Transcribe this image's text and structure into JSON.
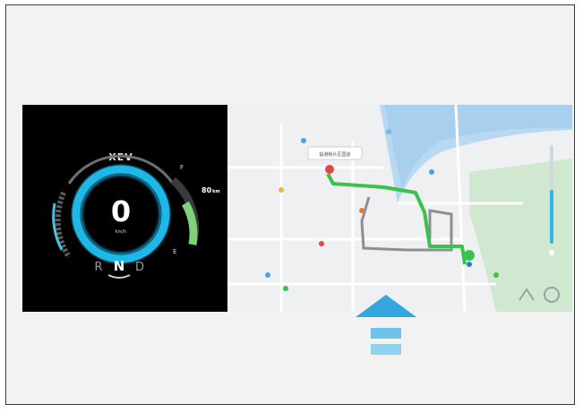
{
  "cluster": {
    "brand": "XEV",
    "speed": "0",
    "speed_unit": "km/h",
    "gear": {
      "r": "R",
      "n": "N",
      "d": "D",
      "selected": "N"
    },
    "range": "80",
    "range_unit": "km",
    "battery_level": 0.55,
    "gauge_top_label": "F",
    "gauge_bottom_label": "E"
  },
  "map": {
    "destination_label": "临港新片区国道",
    "route_color": "#3cc24a",
    "alt_route_color": "#8f8f8f",
    "water_color": "#b9d9f3"
  },
  "colors": {
    "accent": "#2db6e8",
    "gauge_glow": "#1fb7e6",
    "arrow": "#35a7df"
  }
}
